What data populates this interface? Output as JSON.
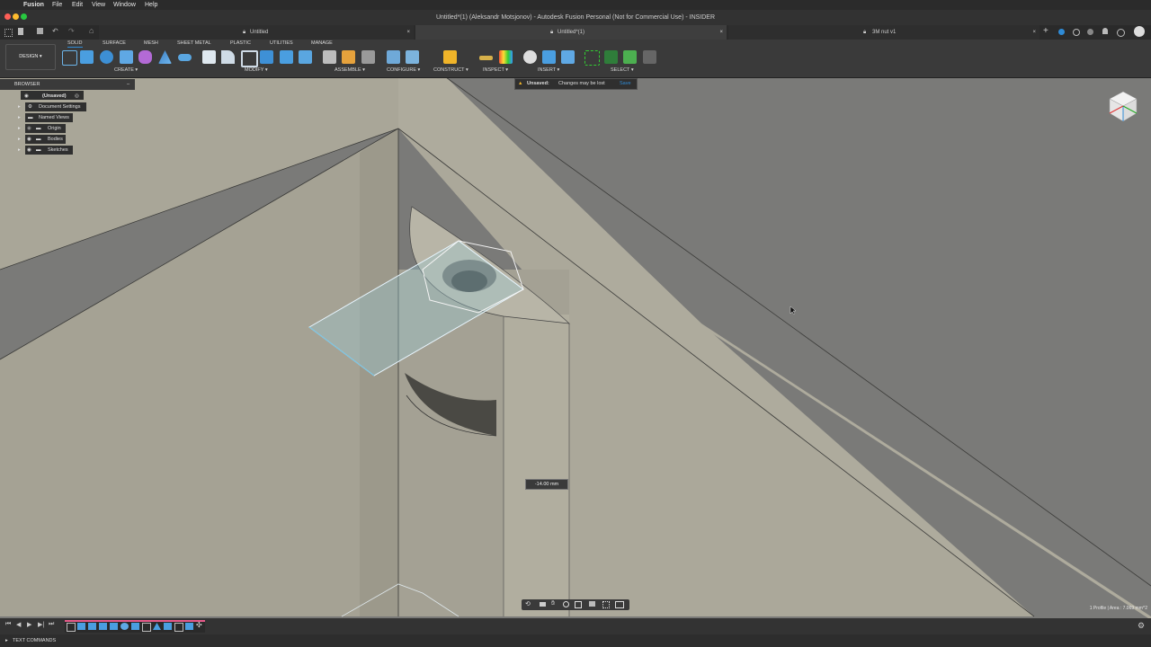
{
  "menubar": {
    "app": "Fusion",
    "items": [
      "File",
      "Edit",
      "View",
      "Window",
      "Help"
    ]
  },
  "window": {
    "title": "Untitled*(1) (Aleksandr Motsjonov) - Autodesk Fusion Personal (Not for Commercial Use) - INSIDER"
  },
  "tabs": [
    {
      "label": "Untitled"
    },
    {
      "label": "Untitled*(1)"
    },
    {
      "label": "3M nut v1"
    }
  ],
  "toolbar": {
    "workspace": "DESIGN",
    "tabs": [
      "SOLID",
      "SURFACE",
      "MESH",
      "SHEET METAL",
      "PLASTIC",
      "UTILITIES",
      "MANAGE"
    ],
    "groups": [
      "CREATE",
      "MODIFY",
      "ASSEMBLE",
      "CONFIGURE",
      "CONSTRUCT",
      "INSPECT",
      "INSERT",
      "SELECT"
    ]
  },
  "browser": {
    "title": "BROWSER",
    "root": "(Unsaved)",
    "items": [
      "Document Settings",
      "Named Views",
      "Origin",
      "Bodies",
      "Sketches"
    ]
  },
  "unsaved": {
    "label": "Unsaved:",
    "message": "Changes may be lost",
    "action": "Save"
  },
  "viewport": {
    "dimension": "-14.00 mm",
    "status": "1 Profile | Area : 7.069 mm^2"
  },
  "bottom": {
    "text_commands": "TEXT COMMANDS"
  },
  "colors": {
    "accent": "#2f8bd6",
    "face_light": "#b0ad9f",
    "face_dark": "#8c8a80",
    "background": "#7c7c7a"
  }
}
